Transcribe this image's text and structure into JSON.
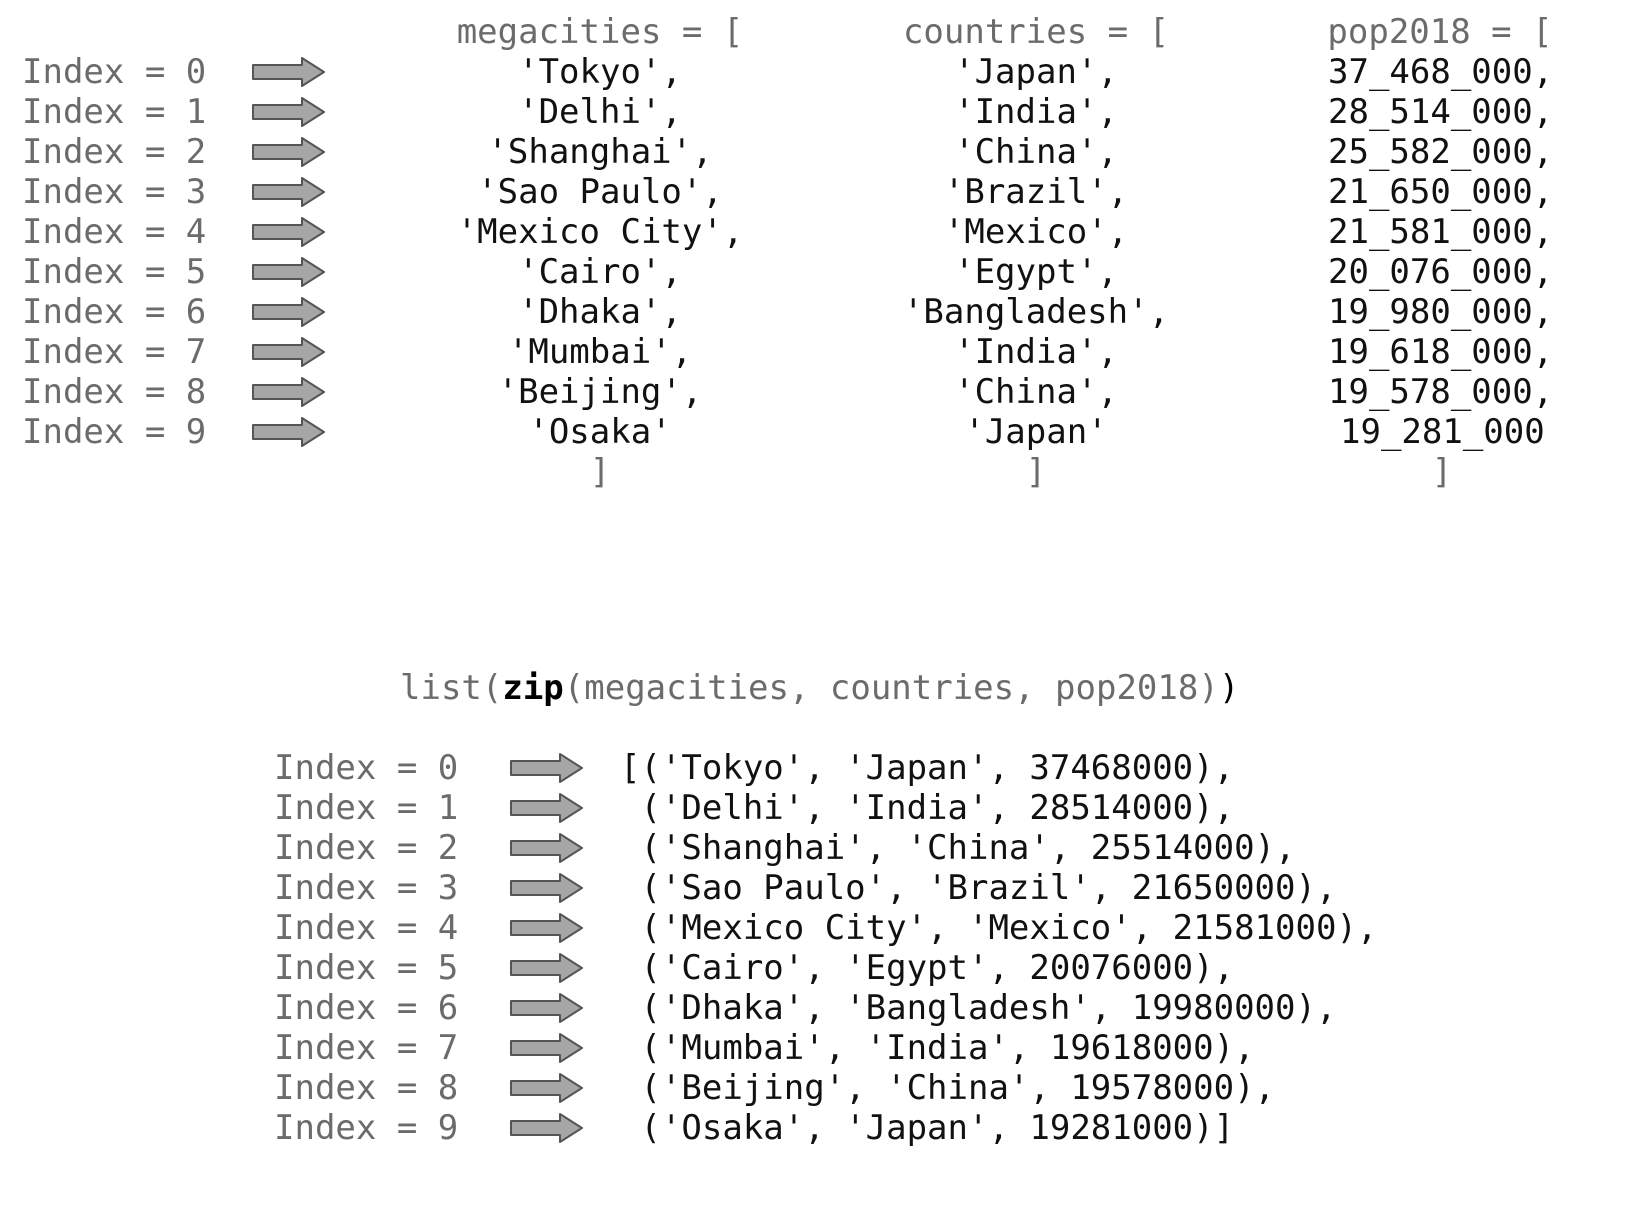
{
  "top": {
    "headers": {
      "megacities": "megacities = [",
      "countries": "countries = [",
      "pop2018": "pop2018 = ["
    },
    "index_labels": [
      "Index = 0",
      "Index = 1",
      "Index = 2",
      "Index = 3",
      "Index = 4",
      "Index = 5",
      "Index = 6",
      "Index = 7",
      "Index = 8",
      "Index = 9"
    ],
    "megacities": [
      "'Tokyo',",
      "'Delhi',",
      "'Shanghai',",
      "'Sao Paulo',",
      "'Mexico City',",
      "'Cairo',",
      "'Dhaka',",
      "'Mumbai',",
      "'Beijing',",
      "'Osaka'"
    ],
    "countries": [
      "'Japan',",
      "'India',",
      "'China',",
      "'Brazil',",
      "'Mexico',",
      "'Egypt',",
      "'Bangladesh',",
      "'India',",
      "'China',",
      "'Japan'"
    ],
    "pop2018": [
      "37_468_000,",
      "28_514_000,",
      "25_582_000,",
      "21_650_000,",
      "21_581_000,",
      "20_076_000,",
      "19_980_000,",
      "19_618_000,",
      "19_578_000,",
      "19_281_000"
    ],
    "closing": {
      "megacities": "]",
      "countries": "]",
      "pop2018": "]"
    }
  },
  "zip_call": {
    "prefix": "list(",
    "func": "zip",
    "args": "(megacities, countries, pop2018)",
    "close": ")"
  },
  "bottom": {
    "index_labels": [
      "Index = 0",
      "Index = 1",
      "Index = 2",
      "Index = 3",
      "Index = 4",
      "Index = 5",
      "Index = 6",
      "Index = 7",
      "Index = 8",
      "Index = 9"
    ],
    "tuples": [
      "[('Tokyo', 'Japan', 37468000),",
      " ('Delhi', 'India', 28514000),",
      " ('Shanghai', 'China', 25514000),",
      " ('Sao Paulo', 'Brazil', 21650000),",
      " ('Mexico City', 'Mexico', 21581000),",
      " ('Cairo', 'Egypt', 20076000),",
      " ('Dhaka', 'Bangladesh', 19980000),",
      " ('Mumbai', 'India', 19618000),",
      " ('Beijing', 'China', 19578000),",
      " ('Osaka', 'Japan', 19281000)]"
    ]
  },
  "colors": {
    "label_gray": "#6b6b6b",
    "value_black": "#111111",
    "arrow_fill": "#a6a6a6",
    "arrow_stroke": "#555555"
  }
}
